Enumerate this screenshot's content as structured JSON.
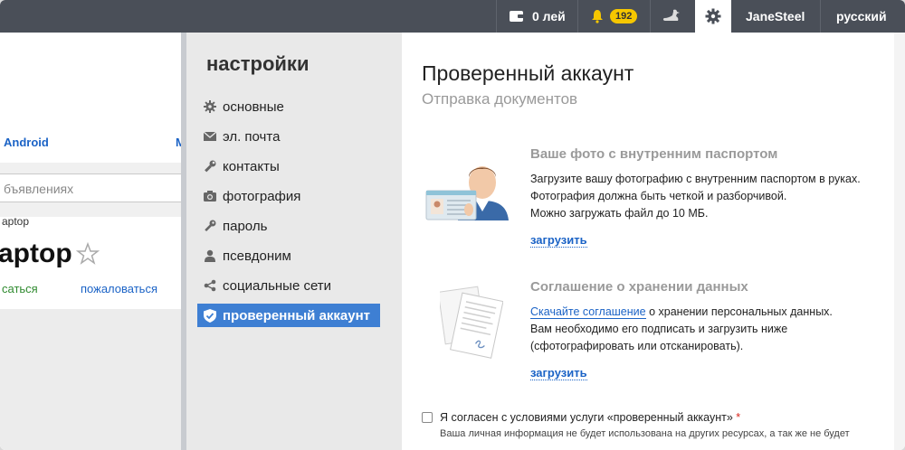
{
  "topbar": {
    "balance": "0 лей",
    "notifications_count": "192",
    "username": "JaneSteel",
    "language": "русский"
  },
  "background_page": {
    "android_link": "Android",
    "cut_link": "М",
    "search_placeholder": "бъявлениях",
    "breadcrumb": "aptop",
    "title": "aptop",
    "action_left": "саться",
    "action_report": "пожаловаться"
  },
  "sidebar": {
    "title": "настройки",
    "items": [
      {
        "label": "основные",
        "icon": "gear-icon"
      },
      {
        "label": "эл. почта",
        "icon": "envelope-icon"
      },
      {
        "label": "контакты",
        "icon": "wrench-icon"
      },
      {
        "label": "фотография",
        "icon": "camera-icon"
      },
      {
        "label": "пароль",
        "icon": "key-icon"
      },
      {
        "label": "псевдоним",
        "icon": "person-icon"
      },
      {
        "label": "социальные сети",
        "icon": "share-icon"
      },
      {
        "label": "проверенный аккаунт",
        "icon": "shield-icon",
        "active": true
      }
    ]
  },
  "main": {
    "title": "Проверенный аккаунт",
    "subtitle": "Отправка документов",
    "photo_section": {
      "title": "Ваше фото с внутренним паспортом",
      "line1": "Загрузите вашу фотографию с внутренним паспортом в руках.",
      "line2": "Фотография должна быть четкой и разборчивой.",
      "line3": "Можно загружать файл до 10 МБ.",
      "upload": "загрузить"
    },
    "agreement_section": {
      "title": "Соглашение о хранении данных",
      "download_link": "Скачайте соглашение",
      "line1_rest": " о хранении персональных данных.",
      "line2": "Вам необходимо его подписать и загрузить ниже",
      "line3": "(сфотографировать или отсканировать).",
      "upload": "загрузить"
    },
    "consent": {
      "label": "Я согласен с условиями услуги «проверенный аккаунт»",
      "required_mark": "*",
      "note": "Ваша личная информация не будет использована на других ресурсах, а так же не будет"
    }
  },
  "colors": {
    "topbar": "#4a4f58",
    "accent": "#3e7fd3",
    "link": "#1b63c6",
    "badge": "#f6c700"
  }
}
